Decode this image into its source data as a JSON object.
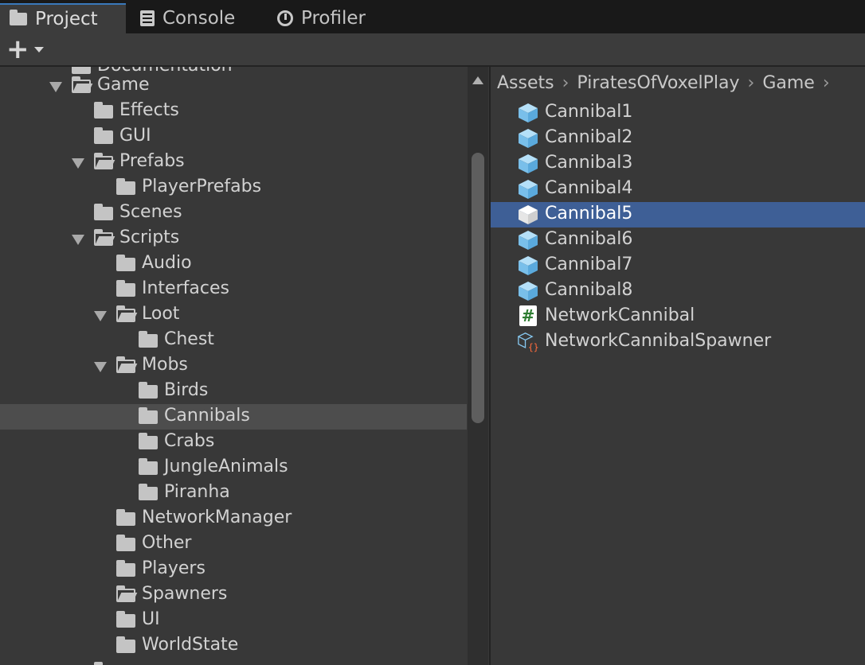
{
  "tabs": [
    {
      "label": "Project",
      "icon": "folder-icon",
      "active": true
    },
    {
      "label": "Console",
      "icon": "console-icon",
      "active": false
    },
    {
      "label": "Profiler",
      "icon": "profiler-icon",
      "active": false
    }
  ],
  "toolbar": {
    "create_label": "+"
  },
  "tree": {
    "partial_top": "Documentation",
    "items": [
      {
        "label": "Game",
        "open": true
      },
      {
        "label": "Effects"
      },
      {
        "label": "GUI"
      },
      {
        "label": "Prefabs",
        "open": true
      },
      {
        "label": "PlayerPrefabs"
      },
      {
        "label": "Scenes"
      },
      {
        "label": "Scripts",
        "open": true
      },
      {
        "label": "Audio"
      },
      {
        "label": "Interfaces"
      },
      {
        "label": "Loot",
        "open": true
      },
      {
        "label": "Chest"
      },
      {
        "label": "Mobs",
        "open": true
      },
      {
        "label": "Birds"
      },
      {
        "label": "Cannibals",
        "selected": true
      },
      {
        "label": "Crabs"
      },
      {
        "label": "JungleAnimals"
      },
      {
        "label": "Piranha"
      },
      {
        "label": "NetworkManager"
      },
      {
        "label": "Other"
      },
      {
        "label": "Players"
      },
      {
        "label": "Spawners",
        "open": true
      },
      {
        "label": "UI"
      },
      {
        "label": "WorldState"
      }
    ]
  },
  "breadcrumb": [
    "Assets",
    "PiratesOfVoxelPlay",
    "Game"
  ],
  "assets": [
    {
      "label": "Cannibal1",
      "icon": "prefab-cube-icon"
    },
    {
      "label": "Cannibal2",
      "icon": "prefab-cube-icon"
    },
    {
      "label": "Cannibal3",
      "icon": "prefab-cube-icon"
    },
    {
      "label": "Cannibal4",
      "icon": "prefab-cube-icon"
    },
    {
      "label": "Cannibal5",
      "icon": "prefab-cube-icon",
      "selected": true
    },
    {
      "label": "Cannibal6",
      "icon": "prefab-cube-icon"
    },
    {
      "label": "Cannibal7",
      "icon": "prefab-cube-icon"
    },
    {
      "label": "Cannibal8",
      "icon": "prefab-cube-icon"
    },
    {
      "label": "NetworkCannibal",
      "icon": "csharp-script-icon"
    },
    {
      "label": "NetworkCannibalSpawner",
      "icon": "prefab-variant-icon"
    }
  ],
  "colors": {
    "selection": "#3e5f96",
    "prefab": "#87c8f0",
    "accent": "#3a79bb"
  }
}
